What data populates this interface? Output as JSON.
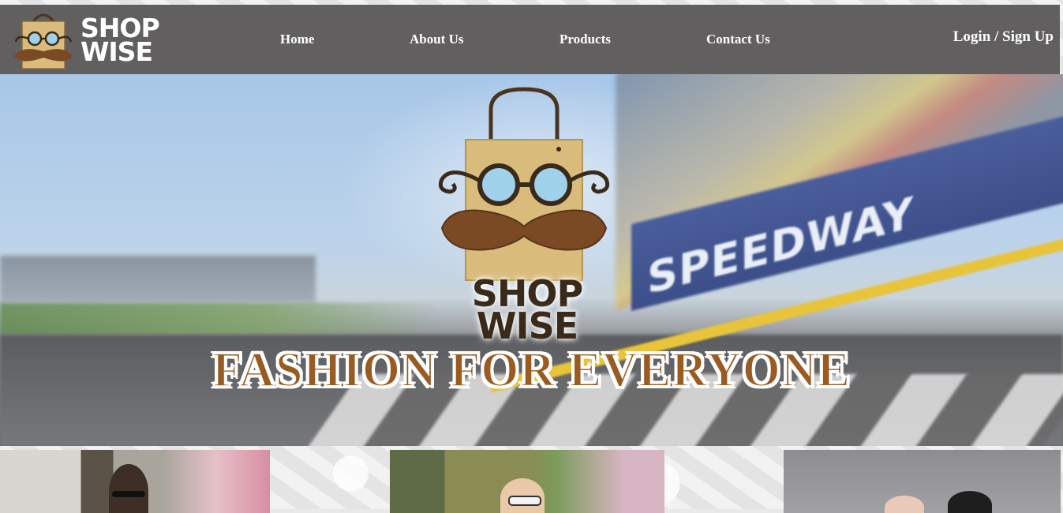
{
  "brand": {
    "line1": "SHOP",
    "line2": "WISE"
  },
  "nav": [
    {
      "label": "Home"
    },
    {
      "label": "About Us"
    },
    {
      "label": "Products"
    },
    {
      "label": "Contact Us"
    }
  ],
  "auth": {
    "label": "Login / Sign Up"
  },
  "hero": {
    "logo_line1": "SHOP",
    "logo_line2": "WISE",
    "tagline": "FASHION FOR EVERYONE",
    "background_sign": "SPEEDWAY"
  },
  "colors": {
    "header_bg": "#625f61",
    "tagline": "#9a5b21",
    "bag": "#d9bb7c",
    "mustache": "#7a4a24"
  },
  "products": [
    {
      "icon": "product-photo-man"
    },
    {
      "icon": "product-photo-woman"
    },
    {
      "icon": "product-photo-children"
    }
  ]
}
